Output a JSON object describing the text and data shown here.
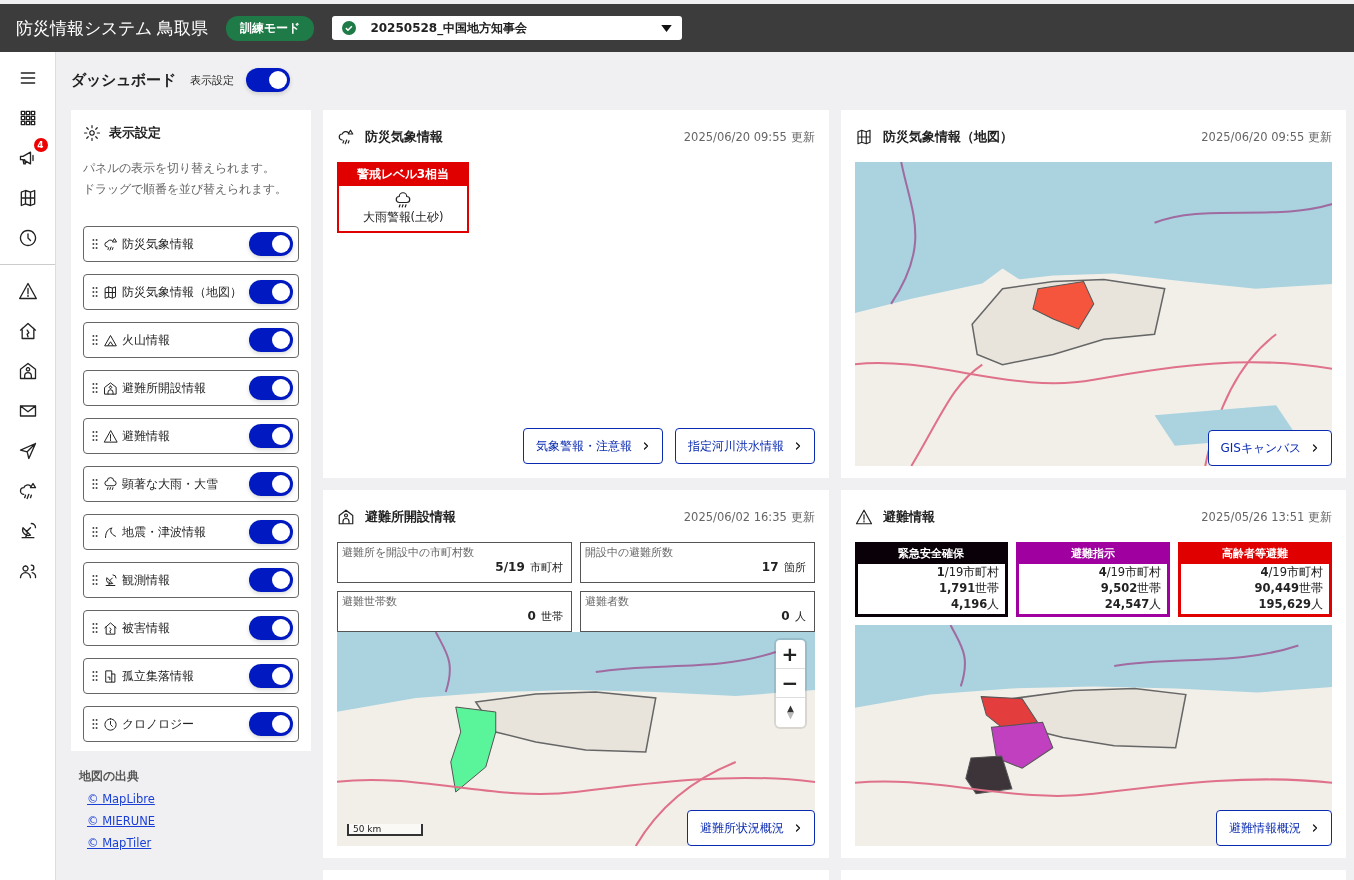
{
  "header": {
    "title": "防災情報システム 鳥取県",
    "mode_badge": "訓練モード",
    "event": {
      "label": "20250528_中国地方知事会",
      "ok": true
    }
  },
  "rail": [
    [
      {
        "kind": "menu"
      },
      {
        "kind": "grid"
      },
      {
        "kind": "megaphone",
        "badge": "4"
      },
      {
        "kind": "map"
      },
      {
        "kind": "clock"
      }
    ],
    [
      {
        "kind": "warning"
      },
      {
        "kind": "house"
      },
      {
        "kind": "shelter"
      },
      {
        "kind": "mail"
      },
      {
        "kind": "send"
      },
      {
        "kind": "storm"
      },
      {
        "kind": "satellite"
      },
      {
        "kind": "people"
      }
    ]
  ],
  "page": {
    "title": "ダッシュボード",
    "toggle_label": "表示設定",
    "toggle_on": true
  },
  "settings_panel": {
    "title": "表示設定",
    "description": [
      "パネルの表示を切り替えられます。",
      "ドラッグで順番を並び替えられます。"
    ],
    "items": [
      {
        "label": "防災気象情報",
        "kind": "storm",
        "on": true
      },
      {
        "label": "防災気象情報（地図）",
        "kind": "map",
        "on": true
      },
      {
        "label": "火山情報",
        "kind": "mountain",
        "on": true
      },
      {
        "label": "避難所開設情報",
        "kind": "shelter",
        "on": true
      },
      {
        "label": "避難情報",
        "kind": "warning",
        "on": true
      },
      {
        "label": "顕著な大雨・大雪",
        "kind": "rain",
        "on": true
      },
      {
        "label": "地震・津波情報",
        "kind": "wave",
        "on": true
      },
      {
        "label": "観測情報",
        "kind": "satellite",
        "on": true
      },
      {
        "label": "被害情報",
        "kind": "house",
        "on": true
      },
      {
        "label": "孤立集落情報",
        "kind": "building",
        "on": true
      },
      {
        "label": "クロノロジー",
        "kind": "clock",
        "on": true
      }
    ]
  },
  "map_credits": {
    "title": "地図の出典",
    "links": [
      "© MapLibre",
      "© MIERUNE",
      "© MapTiler"
    ]
  },
  "weather_card": {
    "title": "防災気象情報",
    "updated": "2025/06/20 09:55 更新",
    "alert": {
      "level": "警戒レベル3相当",
      "name": "大雨警報(土砂)"
    },
    "buttons": [
      "気象警報・注意報",
      "指定河川洪水情報"
    ]
  },
  "weather_map_card": {
    "title": "防災気象情報（地図）",
    "updated": "2025/06/20 09:55 更新",
    "button": "GISキャンバス"
  },
  "shelter_card": {
    "title": "避難所開設情報",
    "updated": "2025/06/02 16:35 更新",
    "stats": [
      {
        "label": "避難所を開設中の市町村数",
        "value": "5/19",
        "unit": "市町村"
      },
      {
        "label": "開設中の避難所数",
        "value": "17",
        "unit": "箇所"
      },
      {
        "label": "避難世帯数",
        "value": "0",
        "unit": "世帯"
      },
      {
        "label": "避難者数",
        "value": "0",
        "unit": "人"
      }
    ],
    "zoom_in": "+",
    "zoom_out": "−",
    "scale": "50 km",
    "button": "避難所状況概況"
  },
  "evacuation_card": {
    "title": "避難情報",
    "updated": "2025/05/26 13:51 更新",
    "levels": [
      {
        "label": "緊急安全確保",
        "color": "#0a0008",
        "lines": [
          "**1**/19市町村",
          "**1,791**世帯",
          "**4,196**人"
        ]
      },
      {
        "label": "避難指示",
        "color": "#a000a0",
        "lines": [
          "**4**/19市町村",
          "**9,502**世帯",
          "**24,547**人"
        ]
      },
      {
        "label": "高齢者等避難",
        "color": "#e00000",
        "lines": [
          "**4**/19市町村",
          "**90,449**世帯",
          "**195,629**人"
        ]
      }
    ],
    "button": "避難情報概況"
  }
}
